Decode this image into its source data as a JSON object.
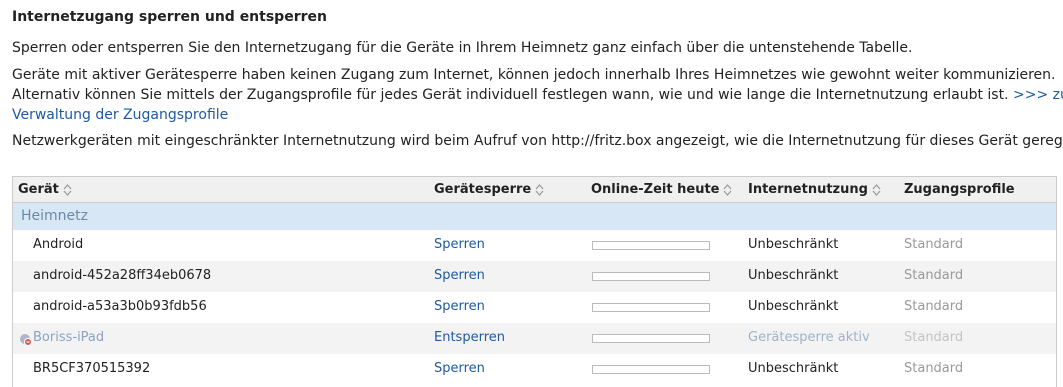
{
  "header": {
    "title": "Internetzugang sperren und entsperren"
  },
  "intro": {
    "p1": "Sperren oder entsperren Sie den Internetzugang für die Geräte in Ihrem Heimnetz ganz einfach über die untenstehende Tabelle.",
    "p2_line1": "Geräte mit aktiver Gerätesperre haben keinen Zugang zum Internet, können jedoch innerhalb Ihres Heimnetzes wie gewohnt weiter kommunizieren.",
    "p2_line2": "Alternativ können Sie mittels der Zugangsprofile für jedes Gerät individuell festlegen wann, wie und wie lange die Internetnutzung erlaubt ist.",
    "p2_link_part1": ">>> zur",
    "p2_link_part2": "Verwaltung der Zugangsprofile",
    "p3": "Netzwerkgeräten mit eingeschränkter Internetnutzung wird beim Aufruf von http://fritz.box angezeigt, wie die Internetnutzung für dieses Gerät geregelt ist."
  },
  "table": {
    "columns": {
      "device": "Gerät",
      "lock": "Gerätesperre",
      "online_time": "Online-Zeit heute",
      "usage": "Internetnutzung",
      "profile": "Zugangsprofile"
    },
    "group": "Heimnetz",
    "rows": [
      {
        "name": "Android",
        "lock": "Sperren",
        "usage": "Unbeschränkt",
        "profile": "Standard",
        "online_fraction": 0
      },
      {
        "name": "android-452a28ff34eb0678",
        "lock": "Sperren",
        "usage": "Unbeschränkt",
        "profile": "Standard",
        "online_fraction": 0
      },
      {
        "name": "android-a53a3b0b93fdb56",
        "lock": "Sperren",
        "usage": "Unbeschränkt",
        "profile": "Standard",
        "online_fraction": 0
      },
      {
        "name": "Boriss-iPad",
        "lock": "Entsperren",
        "usage": "Gerätesperre aktiv",
        "profile": "Standard",
        "online_fraction": 0,
        "blocked": true
      },
      {
        "name": "BR5CF370515392",
        "lock": "Sperren",
        "usage": "Unbeschränkt",
        "profile": "Standard",
        "online_fraction": 0
      }
    ]
  },
  "icons": {
    "sort": "sort-updown-icon",
    "blocked": "blocked-device-icon"
  },
  "colors": {
    "link": "#1e5aa0",
    "group_bg": "#d8e7f5",
    "blocked_text": "#8aa3c0"
  }
}
